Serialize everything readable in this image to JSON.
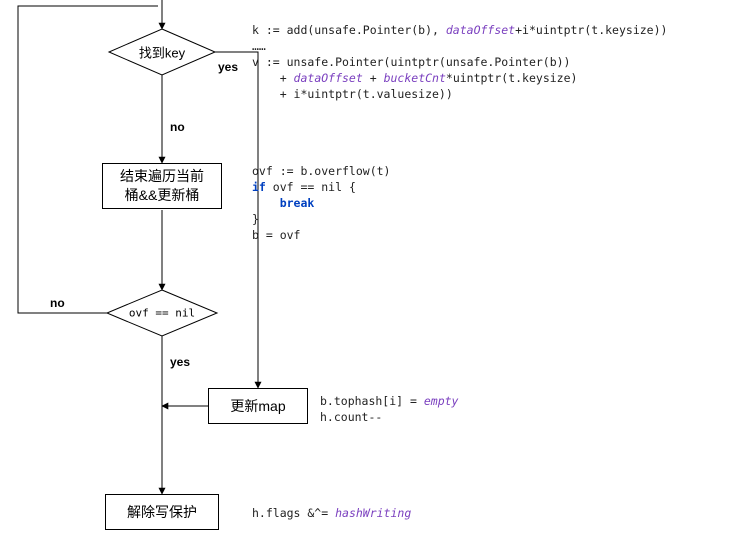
{
  "flow": {
    "decision_findKey": {
      "label": "找到key"
    },
    "decision_ovf": {
      "label": "ovf == nil"
    },
    "process_endIter": {
      "label": "结束遍历当前\n桶&&更新桶"
    },
    "process_updateMap": {
      "label": "更新map"
    },
    "process_releaseWP": {
      "label": "解除写保护"
    }
  },
  "edges": {
    "yes1": "yes",
    "no1": "no",
    "yes2": "yes",
    "no2": "no"
  },
  "code": {
    "block_findKey": {
      "line1_pre": "k := add(unsafe.Pointer(b), ",
      "line1_kw": "dataOffset",
      "line1_post": "+i*uintptr(t.keysize))",
      "line2": "……",
      "line3": "v := unsafe.Pointer(uintptr(unsafe.Pointer(b))",
      "line4_pre": "    + ",
      "line4_kw": "dataOffset",
      "line4_mid": " + ",
      "line4_kw2": "bucketCnt",
      "line4_post": "*uintptr(t.keysize)",
      "line5": "    + i*uintptr(t.valuesize))"
    },
    "block_overflow": {
      "line1": "ovf := b.overflow(t)",
      "line2_pre": "",
      "line2_kw": "if",
      "line2_post": " ovf == nil {",
      "line3_pre": "    ",
      "line3_kw": "break",
      "line4": "}",
      "line5": "b = ovf"
    },
    "block_update": {
      "line1_pre": "b.tophash[i] = ",
      "line1_kw": "empty",
      "line2": "h.count--"
    },
    "block_release": {
      "line1_pre": "h.flags &^= ",
      "line1_kw": "hashWriting"
    }
  }
}
